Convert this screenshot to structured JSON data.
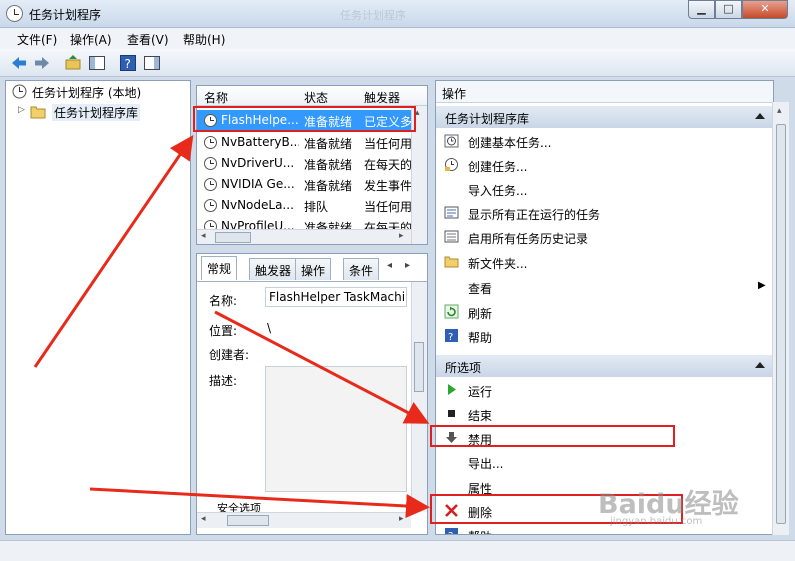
{
  "window": {
    "title": "任务计划程序",
    "watermark": "任务计划程序"
  },
  "menubar": {
    "items": [
      "文件(F)",
      "操作(A)",
      "查看(V)",
      "帮助(H)"
    ]
  },
  "tree": {
    "root": "任务计划程序 (本地)",
    "library": "任务计划程序库"
  },
  "task_list": {
    "columns": [
      "名称",
      "状态",
      "触发器"
    ],
    "rows": [
      {
        "name": "FlashHelpe...",
        "status": "准备就绪",
        "trigger": "已定义多"
      },
      {
        "name": "NvBatteryB...",
        "status": "准备就绪",
        "trigger": "当任何用"
      },
      {
        "name": "NvDriverU...",
        "status": "准备就绪",
        "trigger": "在每天的"
      },
      {
        "name": "NVIDIA Ge...",
        "status": "准备就绪",
        "trigger": "发生事件"
      },
      {
        "name": "NvNodeLa...",
        "status": "排队",
        "trigger": "当任何用"
      },
      {
        "name": "NvProfileU...",
        "status": "准备就绪",
        "trigger": "在每天的"
      }
    ]
  },
  "detail": {
    "tabs": [
      "常规",
      "触发器",
      "操作",
      "条件"
    ],
    "labels": {
      "name": "名称:",
      "location": "位置:",
      "author": "创建者:",
      "description": "描述:",
      "security": "安全选项"
    },
    "name_value": "FlashHelper TaskMachineCore",
    "location_value": "\\"
  },
  "actions": {
    "header": "操作",
    "library_section": "任务计划程序库",
    "library_items": [
      "创建基本任务...",
      "创建任务...",
      "导入任务...",
      "显示所有正在运行的任务",
      "启用所有任务历史记录",
      "新文件夹...",
      "查看",
      "刷新",
      "帮助"
    ],
    "selected_section": "所选项",
    "selected_items": [
      "运行",
      "结束",
      "禁用",
      "导出...",
      "属性",
      "删除",
      "帮助"
    ]
  },
  "watermark": {
    "brand": "Baidu经验",
    "sub": "jingyan.baidu.com"
  },
  "colors": {
    "selection": "#3399ff",
    "highlight_box": "#e02020",
    "arrow": "#e82a1a"
  }
}
